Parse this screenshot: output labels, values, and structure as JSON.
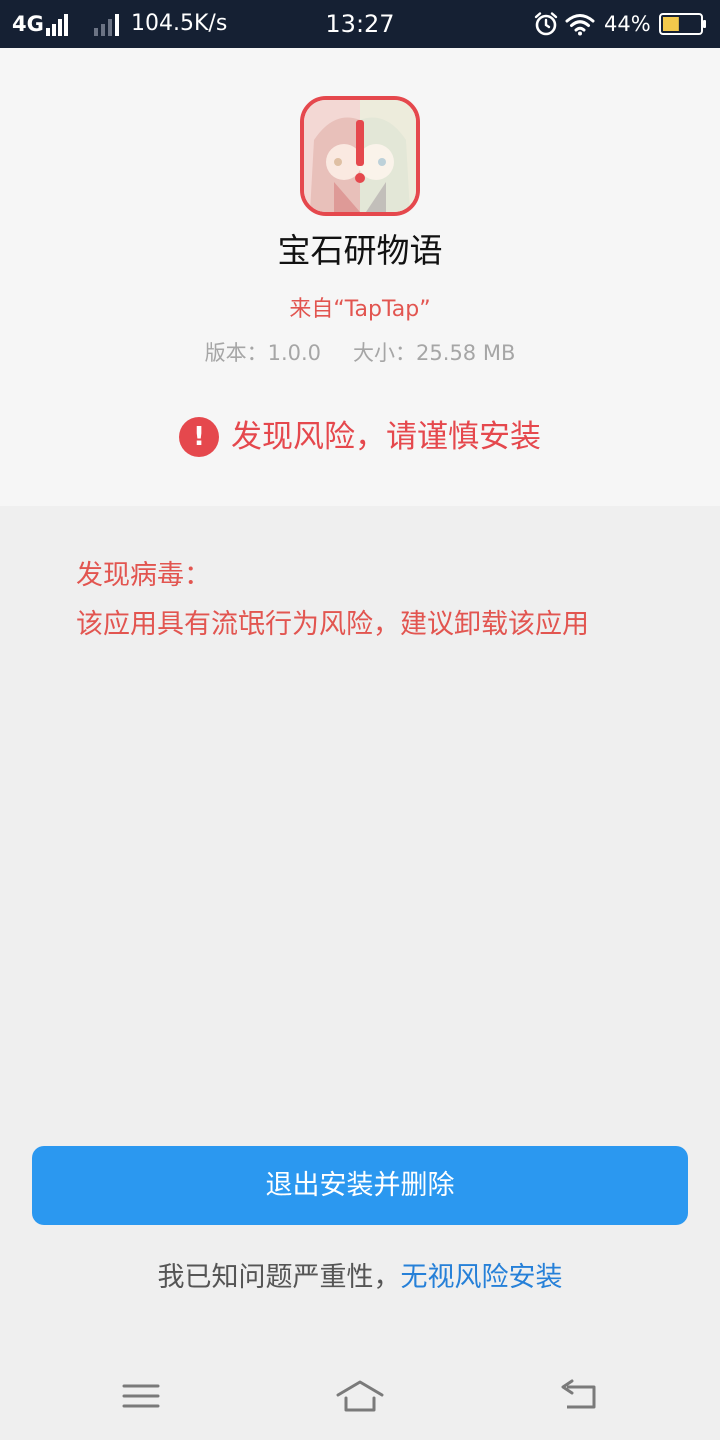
{
  "status_bar": {
    "network": "4G",
    "speed": "104.5K/s",
    "time": "13:27",
    "battery_percent": "44%",
    "battery_level": 0.44,
    "icons": [
      "signal-icon",
      "alarm-icon",
      "wifi-icon",
      "battery-icon"
    ]
  },
  "app": {
    "name": "宝石研物语",
    "source": "来自“TapTap”",
    "version": "版本：1.0.0",
    "size": "大小：25.58 MB"
  },
  "risk": {
    "icon": "!",
    "headline": "发现风险，请谨慎安装"
  },
  "details": {
    "title": "发现病毒：",
    "description": "该应用具有流氓行为风险，建议卸载该应用"
  },
  "actions": {
    "primary": "退出安装并删除",
    "ignore_prefix": "我已知问题严重性，",
    "ignore_link": "无视风险安装"
  },
  "nav": {
    "icons": [
      "menu-icon",
      "home-icon",
      "back-icon"
    ]
  },
  "colors": {
    "status_bar": "#152033",
    "danger": "#e5484d",
    "primary": "#2b98f0",
    "link": "#2680d8"
  }
}
